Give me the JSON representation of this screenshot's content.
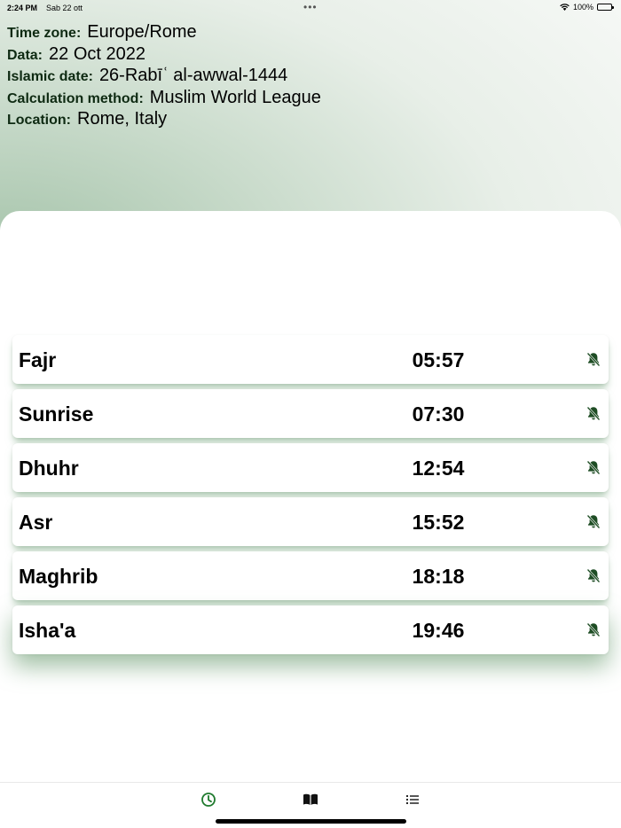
{
  "status_bar": {
    "time": "2:24 PM",
    "date": "Sab 22 ott",
    "dots": "•••",
    "battery": "100%"
  },
  "info": {
    "timezone_label": "Time zone:",
    "timezone": "Europe/Rome",
    "date_label": "Data:",
    "date": "22 Oct 2022",
    "islamic_label": "Islamic date:",
    "islamic_date": "26-Rabīʿ al-awwal-1444",
    "method_label": "Calculation method:",
    "method": "Muslim World League",
    "location_label": "Location:",
    "location": "Rome, Italy"
  },
  "prayers": [
    {
      "name": "Fajr",
      "time": "05:57",
      "icon": "bell-off-icon"
    },
    {
      "name": "Sunrise",
      "time": "07:30",
      "icon": "bell-off-icon"
    },
    {
      "name": "Dhuhr",
      "time": "12:54",
      "icon": "bell-off-icon"
    },
    {
      "name": "Asr",
      "time": "15:52",
      "icon": "bell-off-icon"
    },
    {
      "name": "Maghrib",
      "time": "18:18",
      "icon": "bell-off-icon"
    },
    {
      "name": "Isha'a",
      "time": "19:46",
      "icon": "bell-off-icon"
    }
  ],
  "tabs": [
    {
      "name": "prayer-times",
      "icon": "clock-icon",
      "active": true
    },
    {
      "name": "quran",
      "icon": "book-icon",
      "active": false
    },
    {
      "name": "list",
      "icon": "list-icon",
      "active": false
    }
  ],
  "colors": {
    "accent": "#1f7a2e",
    "label_text": "#0e2a12",
    "bell_icon": "#1e4d24",
    "shadow_green": "#70a076"
  }
}
